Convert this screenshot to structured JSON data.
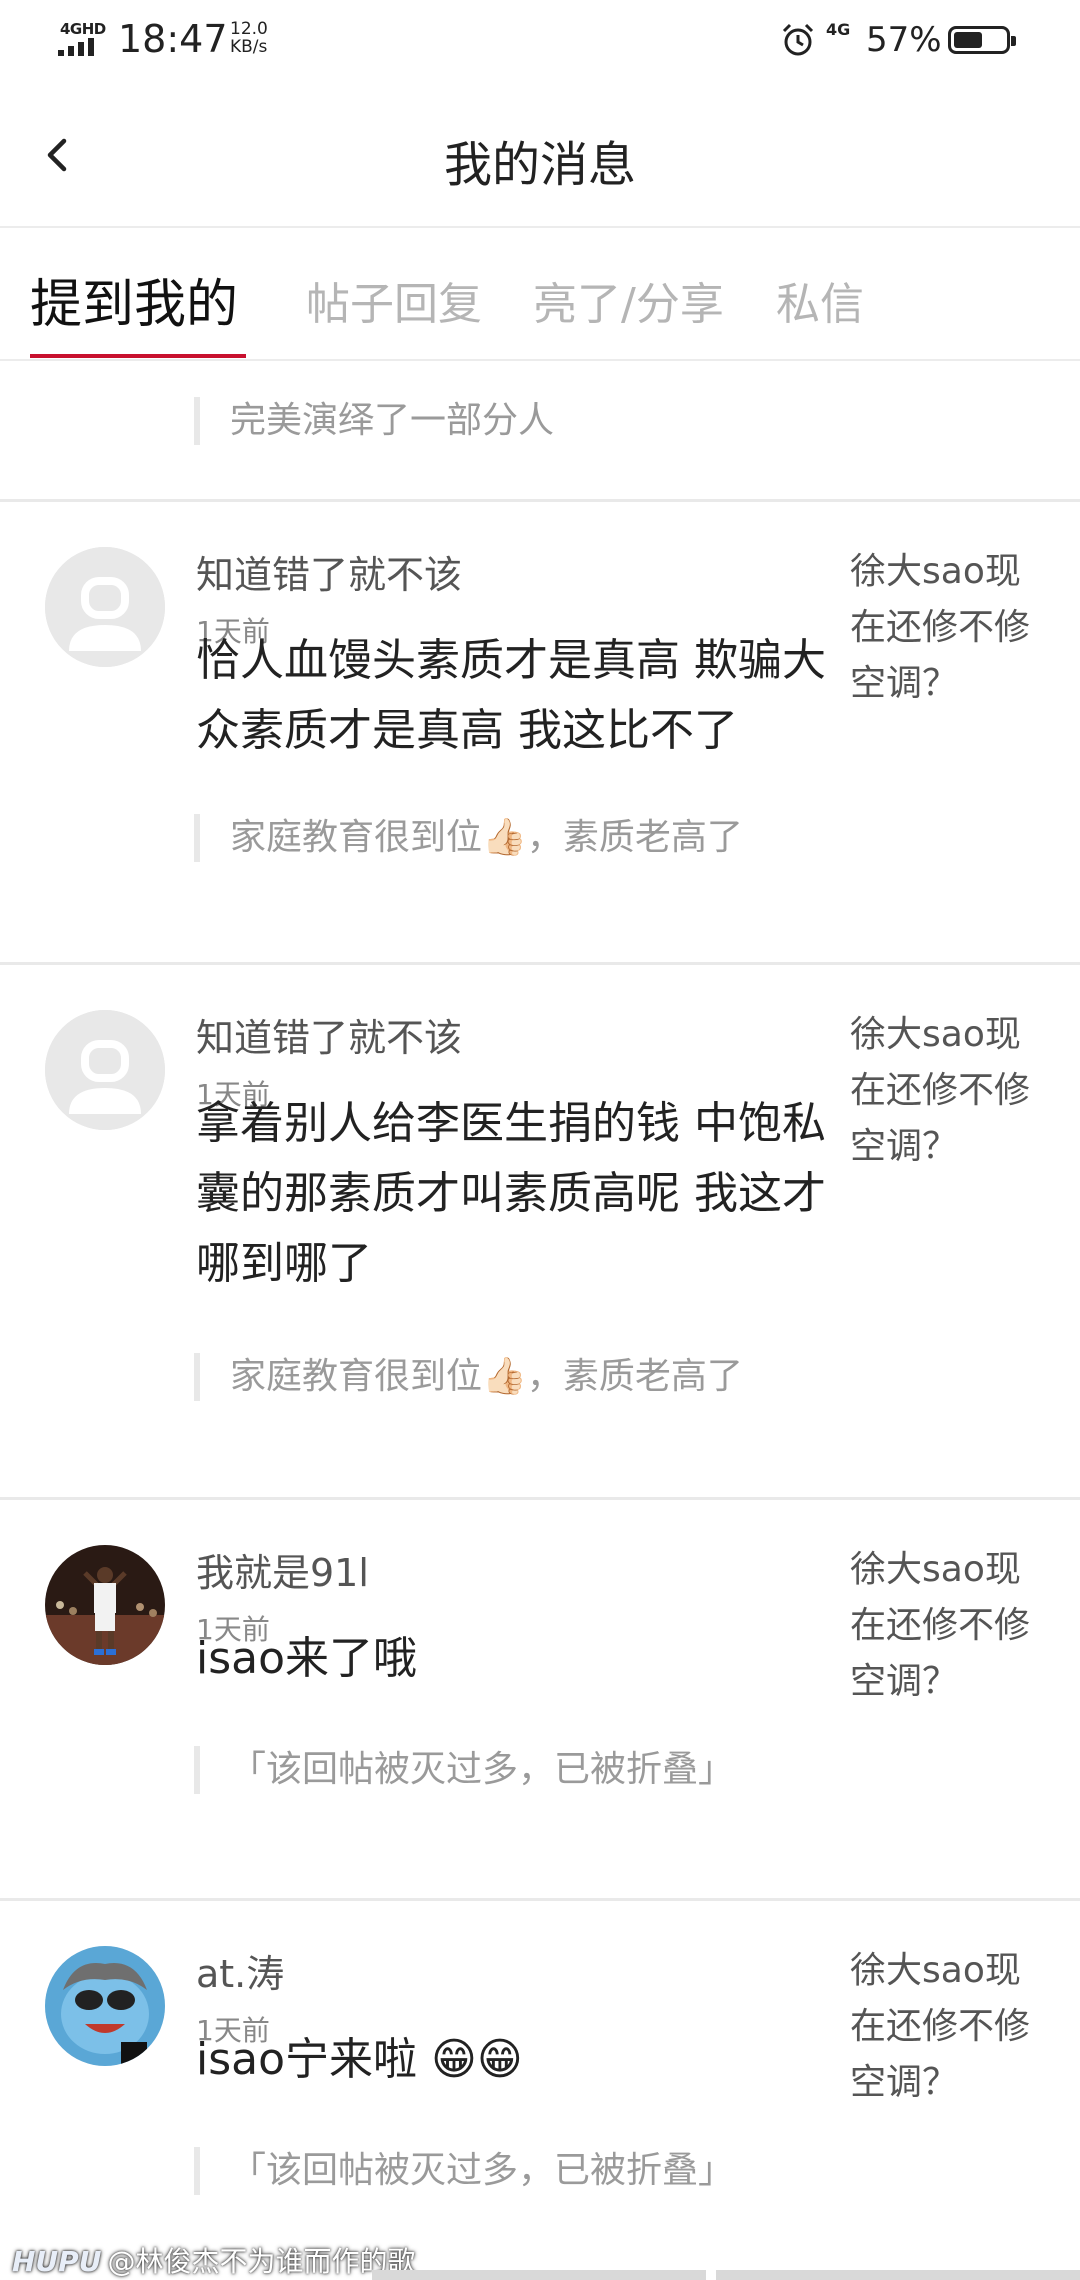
{
  "status_bar": {
    "network_tag": "4GHD",
    "time": "18:47",
    "speed_value": "12.0",
    "speed_unit": "KB/s",
    "net2": "4G",
    "battery": "57%",
    "battery_level": 0.57
  },
  "header": {
    "title": "我的消息"
  },
  "tabs": [
    {
      "label": "提到我的",
      "active": true
    },
    {
      "label": "帖子回复",
      "active": false
    },
    {
      "label": "亮了/分享",
      "active": false
    },
    {
      "label": "私信",
      "active": false
    }
  ],
  "feed": {
    "first_quote": "完美演绎了一部分人",
    "messages": [
      {
        "username": "知道错了就不该",
        "time": "1天前",
        "reference": "徐大sao现在还修不修空调？",
        "content": "恰人血馒头素质才是真高 欺骗大众素质才是真高 我这比不了",
        "quote": "家庭教育很到位👍🏻，素质老高了",
        "avatar_icon": "default-avatar-icon"
      },
      {
        "username": "知道错了就不该",
        "time": "1天前",
        "reference": "徐大sao现在还修不修空调？",
        "content": "拿着别人给李医生捐的钱 中饱私囊的那素质才叫素质高呢 我这才哪到哪了",
        "quote": "家庭教育很到位👍🏻，素质老高了",
        "avatar_icon": "default-avatar-icon"
      },
      {
        "username": "我就是91l",
        "time": "1天前",
        "reference": "徐大sao现在还修不修空调？",
        "content": "isao来了哦",
        "quote": "「该回帖被灭过多，已被折叠」",
        "avatar_icon": "basketball-player-avatar"
      },
      {
        "username": "at.涛",
        "time": "1天前",
        "reference": "徐大sao现在还修不修空调？",
        "content": "isao宁来啦 😁😁",
        "quote": "「该回帖被灭过多，已被折叠」",
        "avatar_icon": "cartoon-avatar"
      }
    ]
  },
  "watermark": {
    "brand": "HUPU",
    "text": "@林俊杰不为谁而作的歌"
  },
  "colors": {
    "accent": "#c8102e",
    "muted": "#b5b5b5",
    "divider": "#e9e9e9"
  }
}
